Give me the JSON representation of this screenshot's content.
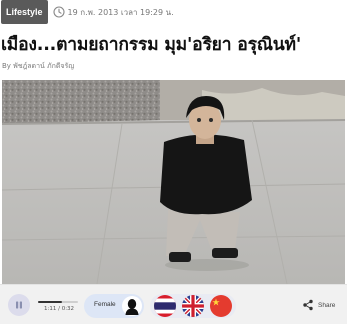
{
  "article": {
    "category": "Lifestyle",
    "timestamp": "19 ก.พ. 2013 เวลา 19:29 น.",
    "headline": "เมือง...ตามยถากรรม มุม'อริยา อรุณินท์'",
    "byline": "By พัชฎ์ลดาน์ ภักดีจรัญ"
  },
  "icons": {
    "timestamp": "clock-icon",
    "play_state": "pause-icon",
    "voice": "person-silhouette-icon",
    "share": "share-icon"
  },
  "player": {
    "state": "paused",
    "time": "1:11 / 0:32",
    "voice_label": "Female",
    "languages": [
      {
        "code": "th",
        "name": "Thai",
        "icon": "thai-flag-icon"
      },
      {
        "code": "en",
        "name": "English",
        "icon": "uk-flag-icon"
      },
      {
        "code": "zh",
        "name": "Chinese",
        "icon": "china-flag-icon"
      }
    ],
    "share_label": "Share"
  },
  "colors": {
    "category_bg": "#5a5a5a",
    "headline": "#111111",
    "player_bg": "#f1f1f1",
    "voice_pill": "#dde6f6"
  }
}
